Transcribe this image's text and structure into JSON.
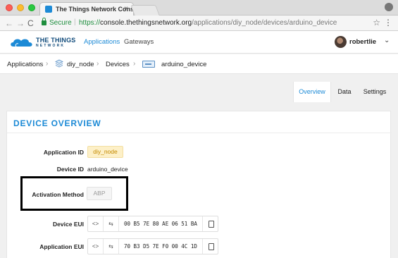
{
  "browser": {
    "tab_title": "The Things Network Console",
    "tab_close": "×",
    "secure_label": "Secure",
    "url_scheme": "https://",
    "url_host": "console.thethingsnetwork.org",
    "url_path": "/applications/diy_node/devices/arduino_device",
    "icons": [
      "back-icon",
      "forward-icon",
      "reload-icon",
      "lock-icon",
      "star-icon",
      "menu-icon",
      "profile-icon"
    ],
    "back_glyph": "←",
    "forward_glyph": "→",
    "reload_glyph": "C",
    "star_glyph": "☆",
    "menu_glyph": "⋮"
  },
  "header": {
    "logo_line1": "THE THINGS",
    "logo_line2": "NETWORK",
    "nav": [
      {
        "label": "Applications",
        "active": true
      },
      {
        "label": "Gateways",
        "active": false
      }
    ],
    "username": "robertlie",
    "chevron": "⌄"
  },
  "breadcrumb": {
    "items": [
      "Applications",
      "diy_node",
      "Devices",
      "arduino_device"
    ],
    "separator": "›"
  },
  "tabs": {
    "items": [
      "Overview",
      "Data",
      "Settings"
    ],
    "active": "Overview"
  },
  "device_overview": {
    "title": "DEVICE OVERVIEW",
    "application_id_label": "Application ID",
    "application_id": "diy_node",
    "device_id_label": "Device ID",
    "device_id": "arduino_device",
    "activation_method_label": "Activation Method",
    "activation_method": "ABP",
    "device_eui_label": "Device EUI",
    "device_eui": "00 B5 7E 80 AE 06 51 BA",
    "application_eui_label": "Application EUI",
    "application_eui": "70 B3 D5 7E F0 00 4C 1D",
    "format_glyph": "<>",
    "swap_glyph": "⇆"
  },
  "colors": {
    "accent": "#1c8ad6",
    "brand_dark": "#124c7c",
    "app_tag_bg": "#fdf0c8",
    "app_tag_text": "#c48a00",
    "secure_green": "#1e8e3e"
  }
}
